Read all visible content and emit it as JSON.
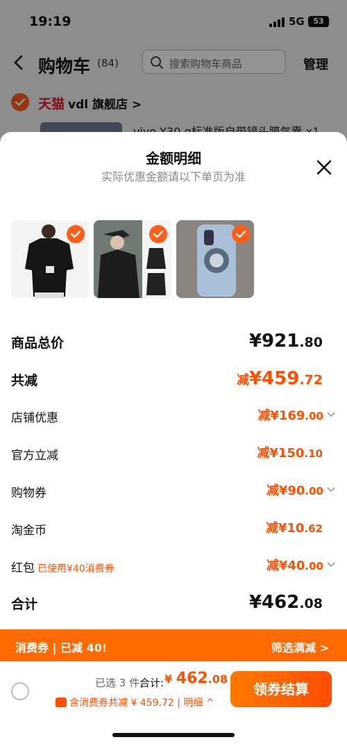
{
  "status_bar": {
    "time": "19:19",
    "network": "5G",
    "battery": "53"
  },
  "header": {
    "title": "购物车",
    "count": "(84)",
    "search_placeholder": "搜索购物车商品",
    "manage": "管理"
  },
  "store": {
    "brand": "天猫",
    "name": "vdl 旗舰店 >"
  },
  "cart_peek": {
    "text": "vivo Y30 g标准版自带镜头膜气囊  x1"
  },
  "sheet": {
    "title": "金额明细",
    "subtitle": "实际优惠金额请以下单页为准",
    "rows": [
      {
        "label": "商品总价",
        "prefix": "",
        "int": "¥921",
        "dec": ".80"
      },
      {
        "label": "共减",
        "prefix": "减",
        "int": "¥459",
        "dec": ".72"
      },
      {
        "label": "店铺优惠",
        "prefix": "减",
        "int": "¥169",
        "dec": ".00"
      },
      {
        "label": "官方立减",
        "prefix": "减",
        "int": "¥150",
        "dec": ".10"
      },
      {
        "label": "购物券",
        "prefix": "减",
        "int": "¥90",
        "dec": ".00"
      },
      {
        "label": "淘金币",
        "prefix": "减",
        "int": "¥10",
        "dec": ".62"
      },
      {
        "label": "红包",
        "note": "已使用¥40消费券",
        "prefix": "减",
        "int": "¥40",
        "dec": ".00"
      },
      {
        "label": "合计",
        "prefix": "",
        "int": "¥462",
        "dec": ".08"
      }
    ]
  },
  "banner": {
    "left": "消费券 | 已减 40!",
    "right": "筛选满减 >"
  },
  "bottom": {
    "selected": "已选 3 件,",
    "total_label": "合计:",
    "total_cur": "¥ ",
    "total_int": "462",
    "total_dec": ".08",
    "coupon_line": "含消费券共减 ¥ 459.72 | 明细 ^",
    "checkout": "领券结算"
  },
  "colors": {
    "accent": "#ff5000",
    "banner": "#ff6a00",
    "tmall_red": "#e21a2c"
  }
}
